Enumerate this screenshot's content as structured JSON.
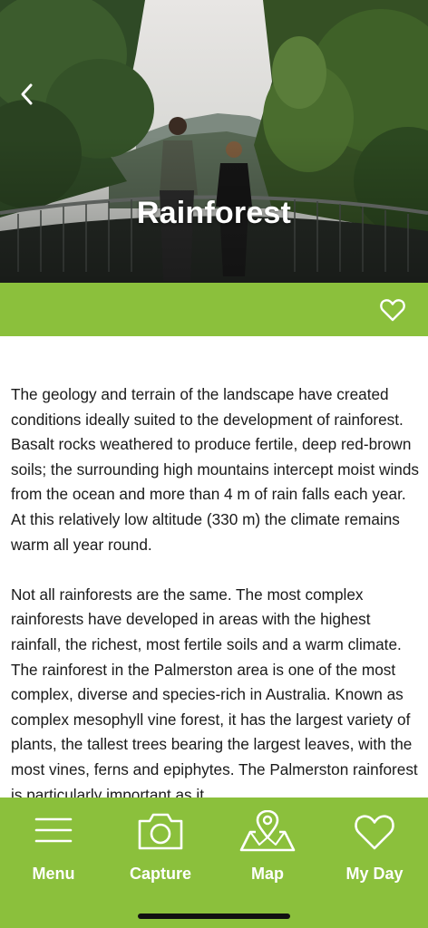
{
  "header": {
    "title": "Rainforest",
    "back_icon": "chevron-left-icon",
    "favorite_icon": "heart-outline-icon"
  },
  "content": {
    "paragraphs": [
      "The geology and terrain of the landscape have created conditions ideally suited to the development of rainforest. Basalt rocks weathered to produce fertile, deep red-brown soils; the surrounding high mountains intercept moist winds from the ocean and more than 4 m of rain falls each year. At this relatively low altitude (330 m) the climate remains warm all year round.",
      "Not all rainforests are the same. The most complex rainforests have developed in areas with the highest rainfall, the richest, most fertile soils and a warm climate. The rainforest in the Palmerston area is one of the most complex, diverse and species-rich in Australia. Known as complex mesophyll vine forest, it has the largest variety of plants, the tallest trees bearing the largest leaves, with the most vines, ferns and epiphytes. The Palmerston rainforest is particularly important as it"
    ]
  },
  "tabbar": {
    "tabs": [
      {
        "label": "Menu",
        "icon": "hamburger-menu-icon"
      },
      {
        "label": "Capture",
        "icon": "camera-icon"
      },
      {
        "label": "Map",
        "icon": "map-pin-icon"
      },
      {
        "label": "My Day",
        "icon": "heart-outline-icon"
      }
    ]
  },
  "colors": {
    "accent": "#8bc03c",
    "text": "#1a1a1a",
    "on_accent": "#ffffff"
  }
}
